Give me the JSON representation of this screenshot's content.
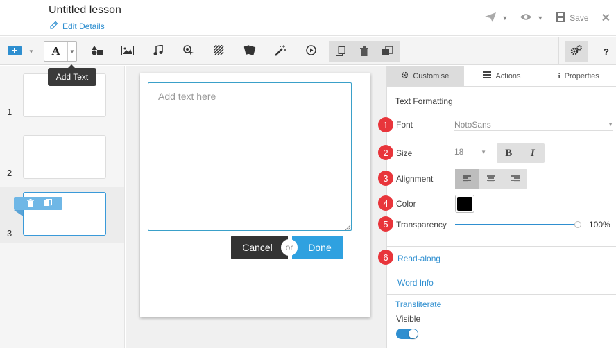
{
  "header": {
    "title": "Untitled lesson",
    "edit_details": "Edit Details",
    "save_label": "Save"
  },
  "toolbar": {
    "tooltip": "Add Text",
    "items": [
      "add-slide-icon",
      "text-icon",
      "shapes-icon",
      "image-icon",
      "music-icon",
      "hotspot-icon",
      "texture-icon",
      "cards-icon",
      "magic-wand-icon",
      "play-icon"
    ],
    "group_items": [
      "copy-icon",
      "trash-icon",
      "duplicate-icon"
    ],
    "help_label": "?"
  },
  "slides": [
    {
      "number": "1",
      "active": false
    },
    {
      "number": "2",
      "active": false
    },
    {
      "number": "3",
      "active": true
    }
  ],
  "editor": {
    "placeholder": "Add text here",
    "cancel_label": "Cancel",
    "or_label": "or",
    "done_label": "Done"
  },
  "panel": {
    "tabs": [
      {
        "label": "Customise",
        "icon": "gear-icon",
        "active": true
      },
      {
        "label": "Actions",
        "icon": "list-icon",
        "active": false
      },
      {
        "label": "Properties",
        "icon": "info-icon",
        "active": false
      }
    ],
    "section_title": "Text Formatting",
    "font_label": "Font",
    "font_value": "NotoSans",
    "size_label": "Size",
    "size_value": "18",
    "bold_label": "B",
    "italic_label": "I",
    "alignment_label": "Alignment",
    "alignment_selected": "left",
    "color_label": "Color",
    "color_value": "#000000",
    "transparency_label": "Transparency",
    "transparency_value": "100%",
    "transparency_fraction": 1.0,
    "read_along": "Read-along",
    "word_info": "Word Info",
    "transliterate": "Transliterate",
    "visible_label": "Visible",
    "visible_on": true
  },
  "annotations": [
    "1",
    "2",
    "3",
    "4",
    "5",
    "6"
  ],
  "colors": {
    "accent": "#2f8fd0",
    "badge": "#e8353b",
    "done": "#2fa1e0",
    "cancel": "#333333"
  }
}
